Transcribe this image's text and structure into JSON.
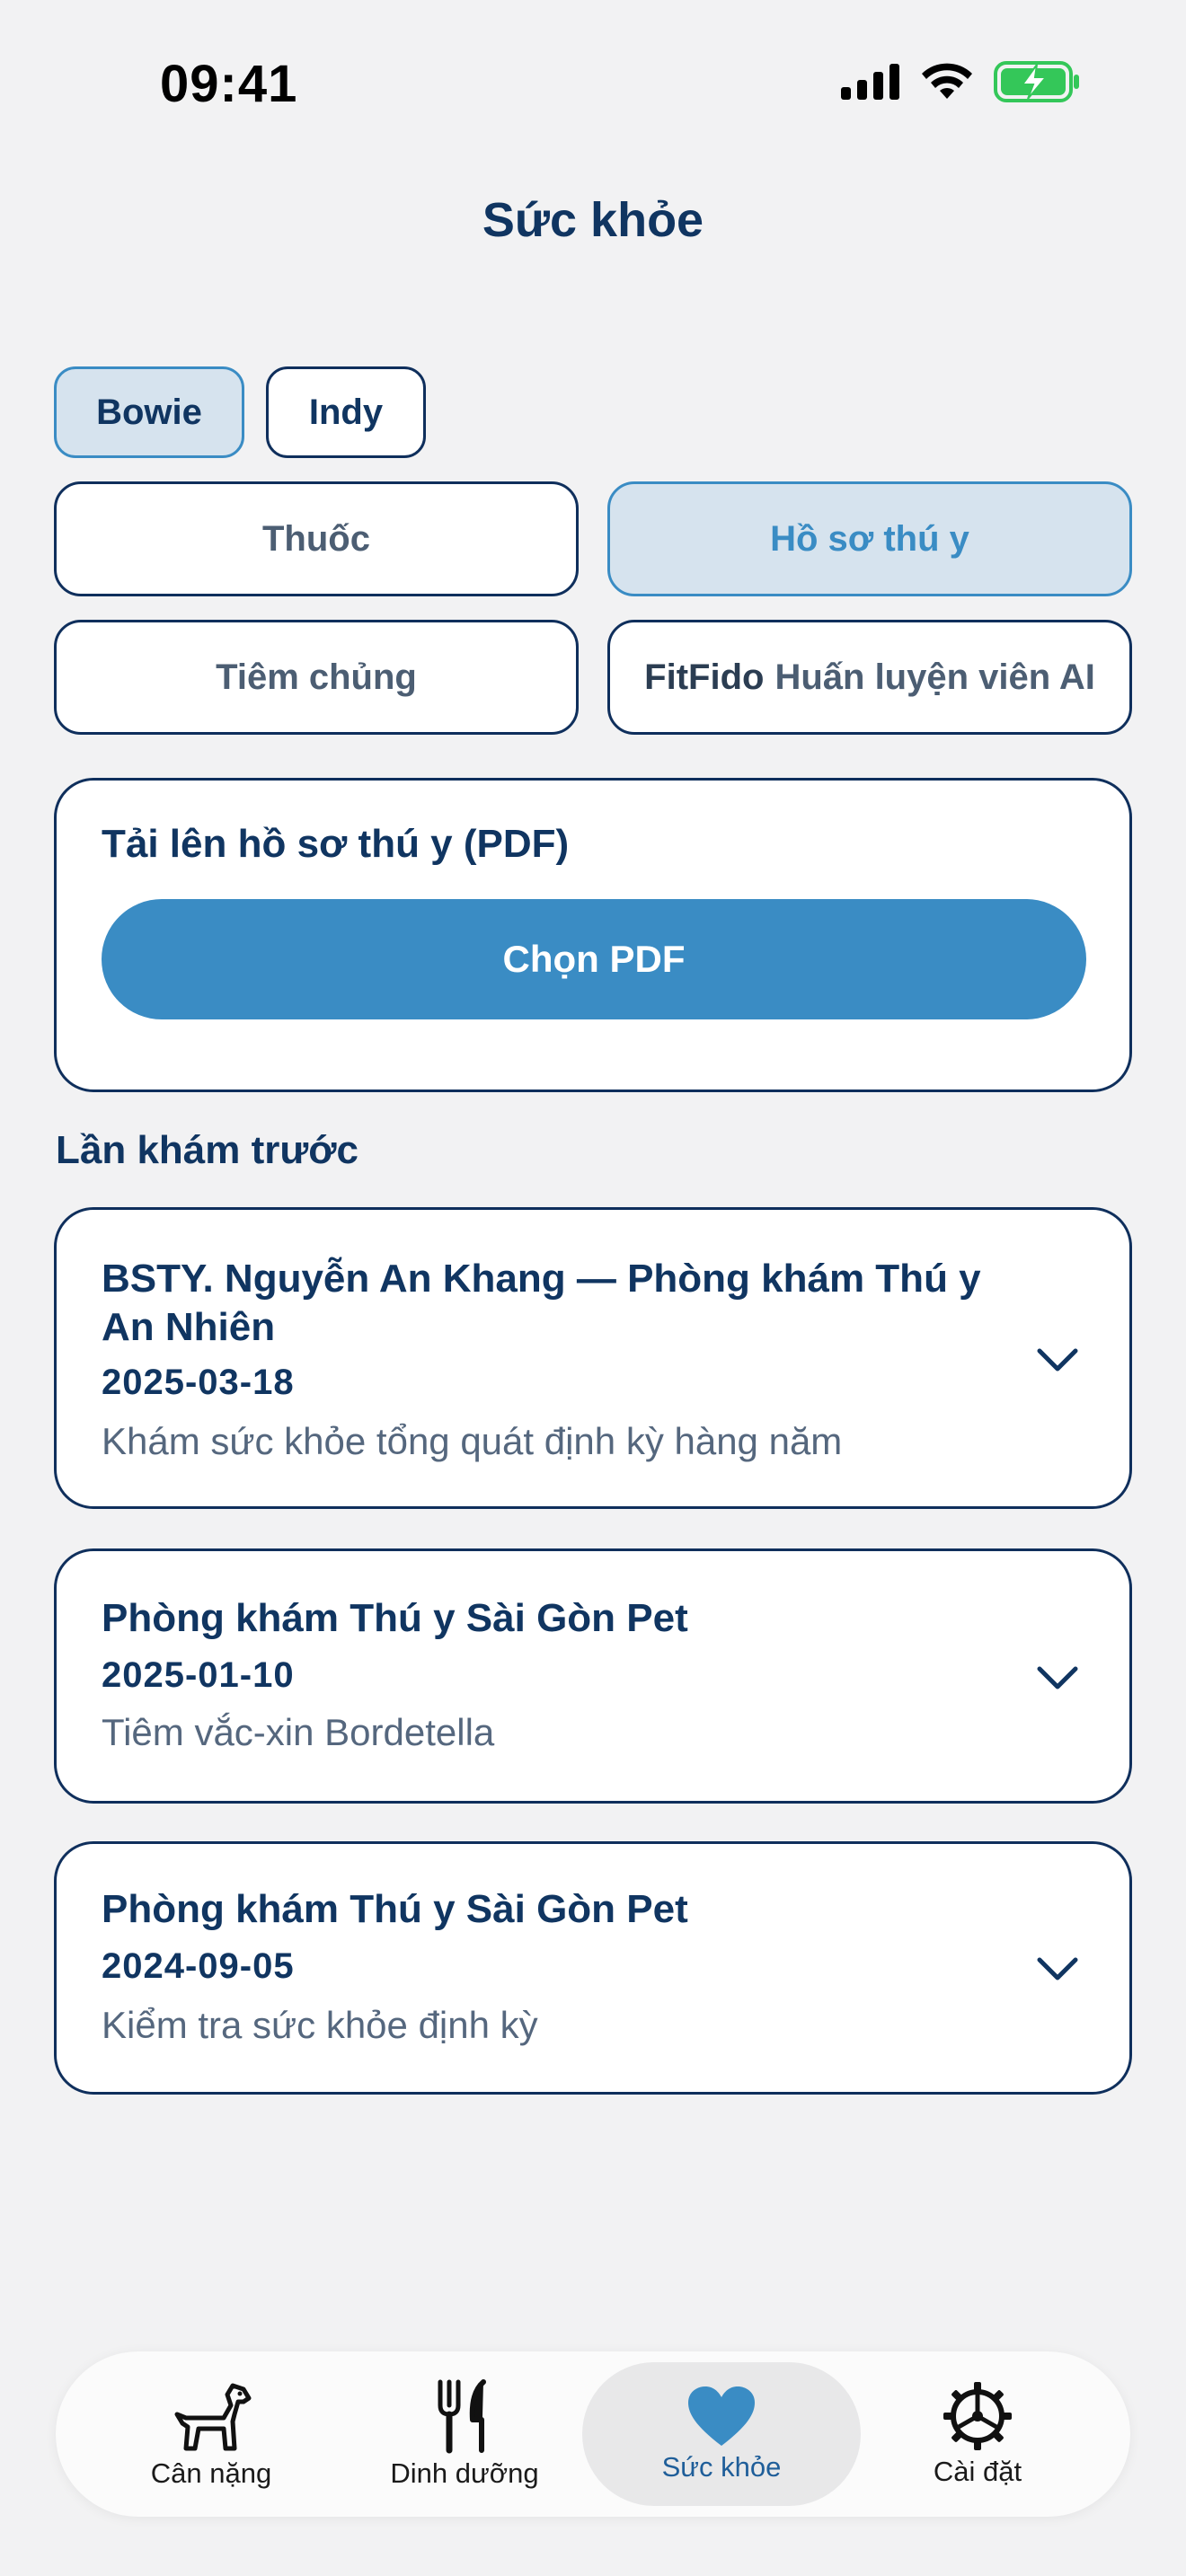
{
  "status_bar": {
    "time": "09:41"
  },
  "header": {
    "title": "Sức khỏe"
  },
  "pets": [
    {
      "name": "Bowie",
      "selected": true
    },
    {
      "name": "Indy",
      "selected": false
    }
  ],
  "segments": {
    "medication": "Thuốc",
    "vet_records": "Hồ sơ thú y",
    "vaccination": "Tiêm chủng",
    "ai_coach_brand": "FitFido",
    "ai_coach_label": "Huấn luyện viên AI",
    "selected": "vet_records"
  },
  "upload": {
    "title": "Tải lên hồ sơ thú y (PDF)",
    "button_label": "Chọn PDF"
  },
  "previous_visits": {
    "heading": "Lần khám trước",
    "items": [
      {
        "title": "BSTY. Nguyễn An Khang — Phòng khám Thú y An Nhiên",
        "date": "2025-03-18",
        "description": "Khám sức khỏe tổng quát định kỳ hàng năm"
      },
      {
        "title": "Phòng khám Thú y Sài Gòn Pet",
        "date": "2025-01-10",
        "description": "Tiêm vắc-xin Bordetella"
      },
      {
        "title": "Phòng khám Thú y Sài Gòn Pet",
        "date": "2024-09-05",
        "description": "Kiểm tra sức khỏe định kỳ"
      }
    ]
  },
  "tab_bar": {
    "tabs": [
      {
        "label": "Cân nặng",
        "icon": "dog-icon"
      },
      {
        "label": "Dinh dưỡng",
        "icon": "fork-knife-icon"
      },
      {
        "label": "Sức khỏe",
        "icon": "heart-icon",
        "active": true
      },
      {
        "label": "Cài đặt",
        "icon": "gear-icon"
      }
    ]
  },
  "colors": {
    "accent": "#3a8cc4",
    "navy": "#103561",
    "background": "#f2f2f3",
    "battery": "#34c759"
  }
}
